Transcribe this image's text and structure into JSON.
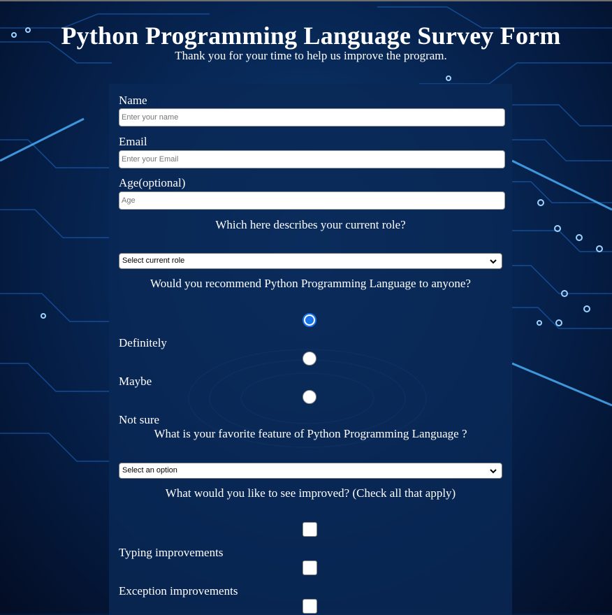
{
  "header": {
    "title": "Python Programming Language Survey Form",
    "subtitle": "Thank you for your time to help us improve the program."
  },
  "form": {
    "name": {
      "label": "Name",
      "placeholder": "Enter your name",
      "value": ""
    },
    "email": {
      "label": "Email",
      "placeholder": "Enter your Email",
      "value": ""
    },
    "age": {
      "label": "Age(optional)",
      "placeholder": "Age",
      "value": ""
    },
    "role": {
      "question": "Which here describes your current role?",
      "selected": "Select current role"
    },
    "recommend": {
      "question": "Would you recommend Python Programming Language to anyone?",
      "options": [
        {
          "label": "Definitely",
          "checked": true
        },
        {
          "label": "Maybe",
          "checked": false
        },
        {
          "label": "Not sure",
          "checked": false
        }
      ]
    },
    "feature": {
      "question": "What is your favorite feature of Python Programming Language ?",
      "selected": "Select an option"
    },
    "improvements": {
      "question": "What would you like to see improved? (Check all that apply)",
      "options": [
        {
          "label": "Typing improvements",
          "checked": false
        },
        {
          "label": "Exception improvements",
          "checked": false
        },
        {
          "label": "",
          "checked": false
        }
      ]
    }
  },
  "colors": {
    "background": "#051d44",
    "panel": "#0a2855",
    "accent": "#1a73e8",
    "circuit": "#3aa0ff"
  },
  "icons": {
    "select_arrow": "chevron-down-icon"
  }
}
